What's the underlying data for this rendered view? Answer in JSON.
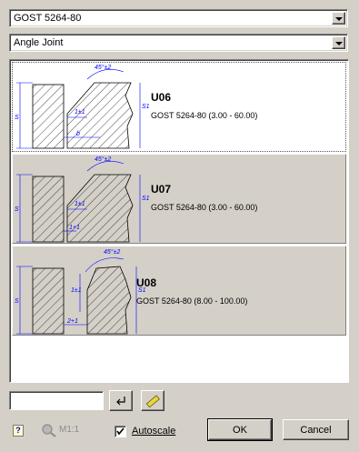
{
  "standard_select": {
    "value": "GOST 5264-80"
  },
  "type_select": {
    "value": "Angle Joint"
  },
  "joints": [
    {
      "code": "U06",
      "standard": "GOST 5264-80 (3.00 - 60.00)",
      "selected": true,
      "dims": {
        "angle": "45°±2",
        "s": "S",
        "s1": "S1",
        "gap": "1±1",
        "b": "b"
      }
    },
    {
      "code": "U07",
      "standard": "GOST 5264-80 (3.00 - 60.00)",
      "selected": false,
      "dims": {
        "angle": "45°±2",
        "s": "S",
        "s1": "S1",
        "gap": "1±1",
        "b": "1+1"
      }
    },
    {
      "code": "U08",
      "standard": "GOST 5264-80 (8.00 - 100.00)",
      "selected": false,
      "dims": {
        "angle": "45°±2",
        "s": "S",
        "s1": "S1",
        "gap": "1±1",
        "b": "2+1"
      }
    }
  ],
  "input": {
    "value": ""
  },
  "zoom_label": "M1:1",
  "autoscale": {
    "label": "Autoscale",
    "checked": true
  },
  "buttons": {
    "ok": "OK",
    "cancel": "Cancel"
  },
  "help_glyph": "?",
  "icons": {
    "apply": "enter-arrow-icon",
    "measure": "ruler-icon",
    "help": "help-icon",
    "zoom": "magnifier-icon"
  },
  "colors": {
    "dim_line": "#0000ff",
    "selection": "#ffffff",
    "face": "#d4d0c8"
  }
}
